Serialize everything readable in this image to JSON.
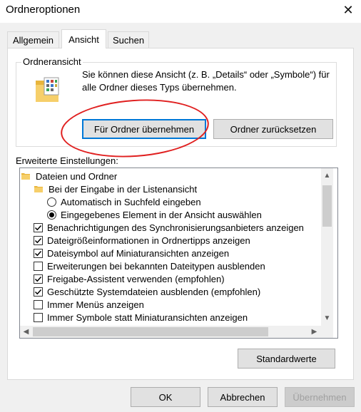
{
  "window": {
    "title": "Ordneroptionen",
    "close_glyph": "✕"
  },
  "tabs": [
    {
      "label": "Allgemein",
      "active": false
    },
    {
      "label": "Ansicht",
      "active": true
    },
    {
      "label": "Suchen",
      "active": false
    }
  ],
  "folder_view": {
    "group_label": "Ordneransicht",
    "description": "Sie können diese Ansicht (z. B. „Details“ oder „Symbole“) für alle Ordner dieses Typs übernehmen.",
    "apply_button": "Für Ordner übernehmen",
    "reset_button": "Ordner zurücksetzen"
  },
  "advanced": {
    "label": "Erweiterte Einstellungen:",
    "items": [
      {
        "type": "folder",
        "text": "Dateien und Ordner"
      },
      {
        "type": "folder",
        "text": "Bei der Eingabe in der Listenansicht"
      },
      {
        "type": "radio",
        "text": "Automatisch in Suchfeld eingeben",
        "selected": false
      },
      {
        "type": "radio",
        "text": "Eingegebenes Element in der Ansicht auswählen",
        "selected": true
      },
      {
        "type": "checkbox",
        "text": "Benachrichtigungen des Synchronisierungsanbieters anzeigen",
        "checked": true
      },
      {
        "type": "checkbox",
        "text": "Dateigrößeinformationen in Ordnertipps anzeigen",
        "checked": true
      },
      {
        "type": "checkbox",
        "text": "Dateisymbol auf Miniaturansichten anzeigen",
        "checked": true
      },
      {
        "type": "checkbox",
        "text": "Erweiterungen bei bekannten Dateitypen ausblenden",
        "checked": false
      },
      {
        "type": "checkbox",
        "text": "Freigabe-Assistent verwenden (empfohlen)",
        "checked": true
      },
      {
        "type": "checkbox",
        "text": "Geschützte Systemdateien ausblenden (empfohlen)",
        "checked": true
      },
      {
        "type": "checkbox",
        "text": "Immer Menüs anzeigen",
        "checked": false
      },
      {
        "type": "checkbox",
        "text": "Immer Symbole statt Miniaturansichten anzeigen",
        "checked": false
      }
    ]
  },
  "defaults_button": "Standardwerte",
  "footer": {
    "ok": "OK",
    "cancel": "Abbrechen",
    "apply": "Übernehmen"
  },
  "colors": {
    "focus_border": "#0078d7",
    "annotation": "#e02020",
    "folder": "#f3c452"
  }
}
